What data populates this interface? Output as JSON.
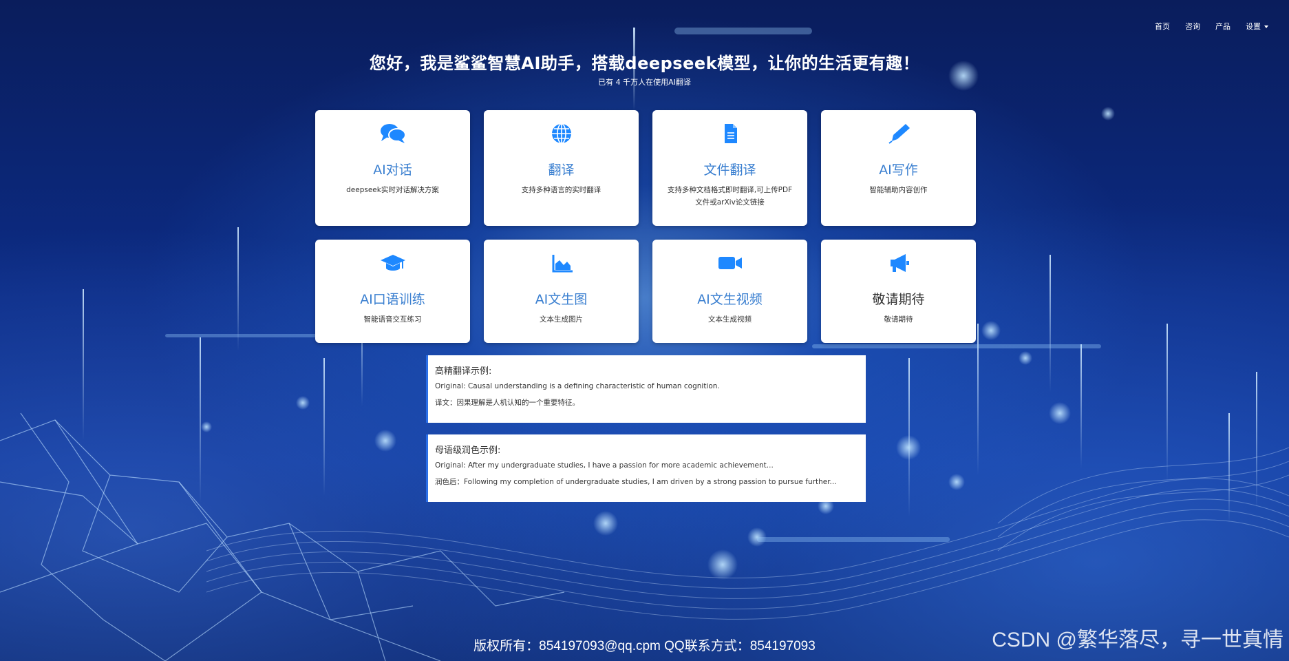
{
  "nav": {
    "home": "首页",
    "consult": "咨询",
    "product": "产品",
    "settings": "设置"
  },
  "hero": {
    "title": "您好，我是鲨鲨智慧AI助手，搭载deepseek模型，让你的生活更有趣！",
    "subtitle": "已有 4 千万人在使用AI翻译"
  },
  "cards": [
    {
      "title": "AI对话",
      "desc": "deepseek实时对话解决方案",
      "icon": "chat-icon"
    },
    {
      "title": "翻译",
      "desc": "支持多种语言的实时翻译",
      "icon": "globe-icon"
    },
    {
      "title": "文件翻译",
      "desc": "支持多种文档格式即时翻译,可上传PDF文件或arXiv论文链接",
      "icon": "document-icon"
    },
    {
      "title": "AI写作",
      "desc": "智能辅助内容创作",
      "icon": "pen-icon"
    },
    {
      "title": "AI口语训练",
      "desc": "智能语音交互练习",
      "icon": "graduation-cap-icon"
    },
    {
      "title": "AI文生图",
      "desc": "文本生成图片",
      "icon": "area-chart-icon"
    },
    {
      "title": "AI文生视频",
      "desc": "文本生成视频",
      "icon": "video-camera-icon"
    },
    {
      "title": "敬请期待",
      "desc": "敬请期待",
      "icon": "megaphone-icon"
    }
  ],
  "examples": [
    {
      "heading": "高精翻译示例:",
      "original": "Original: Causal understanding is a defining characteristic of human cognition.",
      "result": "译文：因果理解是人机认知的一个重要特征。"
    },
    {
      "heading": "母语级润色示例:",
      "original": "Original: After my undergraduate studies, I have a passion for more academic achievement...",
      "result": "润色后：Following my completion of undergraduate studies, I am driven by a strong passion to pursue further..."
    }
  ],
  "footer": "版权所有：854197093@qq.cpm QQ联系方式：854197093",
  "watermark": "CSDN @繁华落尽，寻一世真情",
  "colors": {
    "accent": "#1e88ff",
    "card_title": "#3a7fd0",
    "background": "#0c2c86"
  }
}
